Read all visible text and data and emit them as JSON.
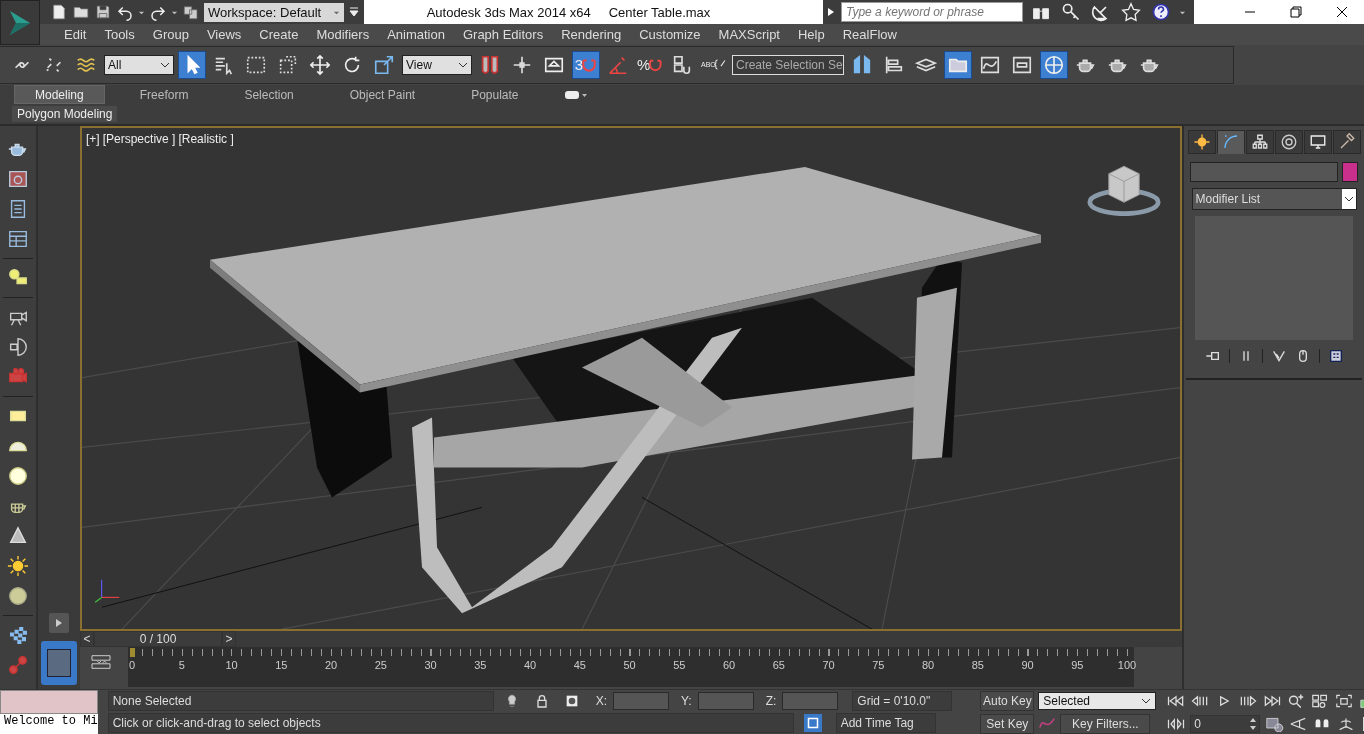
{
  "title_bar": {
    "workspace": "Workspace: Default",
    "title": "Autodesk 3ds Max  2014 x64",
    "file": "Center Table.max",
    "search": {
      "placeholder": "Type a keyword or phrase"
    }
  },
  "menu": [
    "Edit",
    "Tools",
    "Group",
    "Views",
    "Create",
    "Modifiers",
    "Animation",
    "Graph Editors",
    "Rendering",
    "Customize",
    "MAXScript",
    "Help",
    "RealFlow"
  ],
  "main_toolbar": [
    {
      "kind": "link",
      "selected": false
    },
    {
      "kind": "unlink",
      "selected": false
    },
    {
      "kind": "bind",
      "selected": false
    },
    {
      "kind": "dropdown",
      "value": "All"
    },
    {
      "kind": "select",
      "selected": true
    },
    {
      "kind": "select-by-name",
      "selected": false
    },
    {
      "kind": "region",
      "selected": false
    },
    {
      "kind": "crossing",
      "selected": false
    },
    {
      "kind": "move",
      "selected": false
    },
    {
      "kind": "rotate",
      "selected": false
    },
    {
      "kind": "scale",
      "selected": false
    },
    {
      "kind": "dropdown",
      "value": "View"
    },
    {
      "kind": "pivot",
      "selected": false
    },
    {
      "kind": "manipulate",
      "selected": false
    },
    {
      "kind": "shortcut",
      "selected": false
    },
    {
      "kind": "snap",
      "text": "3",
      "selected": true
    },
    {
      "kind": "angle-snap",
      "selected": false
    },
    {
      "kind": "snap",
      "text": "%",
      "selected": false
    },
    {
      "kind": "spinner-snap",
      "selected": false
    },
    {
      "kind": "named-selection",
      "text": "ABC",
      "selected": false
    },
    {
      "kind": "dropdown",
      "value": "Create Selection Se"
    },
    {
      "kind": "mirror",
      "selected": false
    },
    {
      "kind": "align",
      "selected": false
    },
    {
      "kind": "layers",
      "selected": false
    },
    {
      "kind": "scene-explorer",
      "selected": true
    },
    {
      "kind": "curve-editor",
      "selected": false
    },
    {
      "kind": "schematic",
      "selected": false
    },
    {
      "kind": "material",
      "selected": true
    },
    {
      "kind": "teapot",
      "selected": false
    },
    {
      "kind": "teapot",
      "selected": false
    },
    {
      "kind": "teapot",
      "selected": false
    }
  ],
  "ribbon": {
    "tabs": [
      {
        "label": "Modeling",
        "selected": true
      },
      {
        "label": "Freeform",
        "selected": false
      },
      {
        "label": "Selection",
        "selected": false
      },
      {
        "label": "Object Paint",
        "selected": false
      },
      {
        "label": "Populate",
        "selected": false
      }
    ],
    "panel": "Polygon Modeling"
  },
  "viewport": {
    "labels": [
      "[+]",
      "[Perspective ]",
      "[Realistic ]"
    ]
  },
  "command_panel": {
    "tabs": [
      {
        "kind": "create",
        "selected": false
      },
      {
        "kind": "modify",
        "selected": true
      },
      {
        "kind": "hierarchy",
        "selected": false
      },
      {
        "kind": "motion",
        "selected": false
      },
      {
        "kind": "display",
        "selected": false
      },
      {
        "kind": "utilities",
        "selected": false
      }
    ],
    "modifier_list": "Modifier List"
  },
  "time_slider": {
    "prev": "<",
    "position": "0 / 100",
    "next": ">",
    "level": 0
  },
  "track_bar": {
    "ticks": [
      "0",
      "5",
      "10",
      "15",
      "20",
      "25",
      "30",
      "35",
      "40",
      "45",
      "50",
      "55",
      "60",
      "65",
      "70",
      "75",
      "80",
      "85",
      "90",
      "95",
      "100"
    ]
  },
  "status": {
    "script_listener": "Welcome to Mi",
    "selection": "None Selected",
    "prompt": "Click or click-and-drag to select objects",
    "x_label": "X:",
    "y_label": "Y:",
    "z_label": "Z:",
    "grid": "Grid = 0'10.0\"",
    "add_time_tag": "Add Time Tag",
    "auto_key": "Auto Key",
    "set_key": "Set Key",
    "key_mode": "Selected",
    "key_filters": "Key Filters...",
    "frame": "0"
  }
}
